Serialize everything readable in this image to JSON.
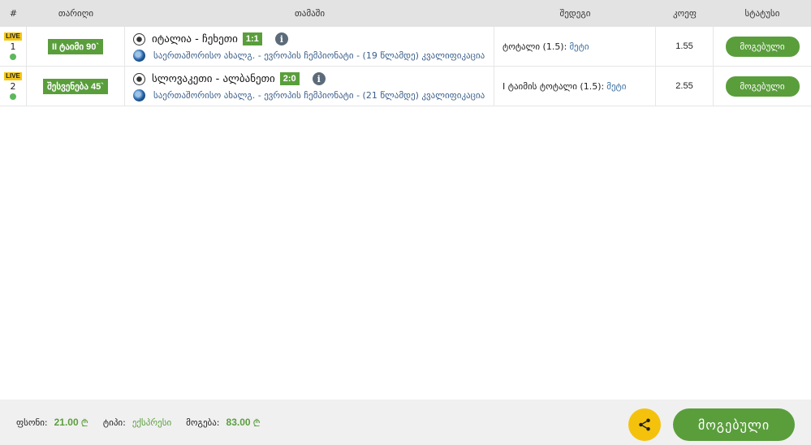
{
  "header": {
    "num": "#",
    "date": "თარიღი",
    "game": "თამაში",
    "bet": "შედეგი",
    "odds": "კოეფ",
    "status": "სტატუსი"
  },
  "rows": [
    {
      "live": "LIVE",
      "index": "1",
      "period": "II ტაიმი 90`",
      "match": "იტალია - ჩეხეთი",
      "score": "1:1",
      "competition": "საერთაშორისო ახალგ. - ევროპის ჩემპიონატი - (19 წლამდე) კვალიფიკაცია",
      "bet_label": "ტოტალი (1.5):",
      "bet_value": "მეტი",
      "odds": "1.55",
      "status": "მოგებული"
    },
    {
      "live": "LIVE",
      "index": "2",
      "period": "შესვენება 45`",
      "match": "სლოვაკეთი - ალბანეთი",
      "score": "2:0",
      "competition": "საერთაშორისო ახალგ. - ევროპის ჩემპიონატი - (21 წლამდე) კვალიფიკაცია",
      "bet_label": "I ტაიმის ტოტალი (1.5):",
      "bet_value": "მეტი",
      "odds": "2.55",
      "status": "მოგებული"
    }
  ],
  "footer": {
    "stake_label": "ფსონი:",
    "stake_value": "21.00",
    "currency": "₾",
    "type_label": "ტიპი:",
    "type_value": "ექსპრესი",
    "win_label": "მოგება:",
    "win_value": "83.00",
    "won_button": "მოგებული",
    "share_icon": "share-icon"
  },
  "colors": {
    "green": "#5a9e3c",
    "yellow": "#f4c20d",
    "live": "#f4c717",
    "link": "#3b6fa0"
  }
}
